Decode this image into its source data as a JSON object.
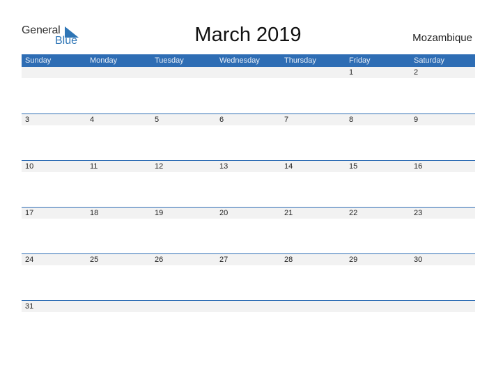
{
  "logo": {
    "word1": "General",
    "word2": "Blue",
    "brand_color": "#2e75b6"
  },
  "title": "March 2019",
  "country": "Mozambique",
  "colors": {
    "header_bg": "#2e6db4",
    "date_band": "#f2f2f2",
    "rule": "#2e6db4"
  },
  "weekdays": [
    "Sunday",
    "Monday",
    "Tuesday",
    "Wednesday",
    "Thursday",
    "Friday",
    "Saturday"
  ],
  "weeks": [
    [
      "",
      "",
      "",
      "",
      "",
      "1",
      "2"
    ],
    [
      "3",
      "4",
      "5",
      "6",
      "7",
      "8",
      "9"
    ],
    [
      "10",
      "11",
      "12",
      "13",
      "14",
      "15",
      "16"
    ],
    [
      "17",
      "18",
      "19",
      "20",
      "21",
      "22",
      "23"
    ],
    [
      "24",
      "25",
      "26",
      "27",
      "28",
      "29",
      "30"
    ],
    [
      "31",
      "",
      "",
      "",
      "",
      "",
      ""
    ]
  ]
}
